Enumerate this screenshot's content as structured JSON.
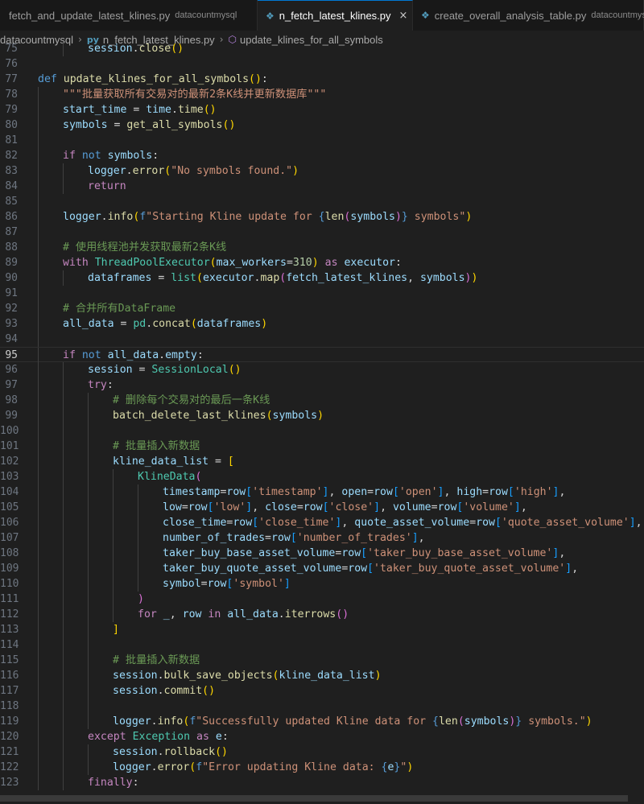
{
  "tabs": [
    {
      "icon": "python-file-icon",
      "label": "fetch_and_update_latest_klines.py",
      "desc": "datacountmysql",
      "active": false
    },
    {
      "icon": "python-file-icon",
      "label": "n_fetch_latest_klines.py",
      "desc": "",
      "active": true,
      "close": "×"
    },
    {
      "icon": "python-file-icon",
      "label": "create_overall_analysis_table.py",
      "desc": "datacountmysql",
      "active": false
    }
  ],
  "breadcrumb": [
    "datacountmysql",
    "n_fetch_latest_klines.py",
    "update_klines_for_all_symbols"
  ],
  "colors": {
    "keyword": "#569cd6",
    "control": "#c586c0",
    "function": "#dcdcaa",
    "string": "#ce9178",
    "comment": "#6a9955",
    "variable": "#9cdcfe",
    "class": "#4ec9b0",
    "accent": "#0078d4"
  },
  "current_line": 95,
  "code_lines": [
    {
      "n": "75",
      "indent": 2,
      "t": [
        [
          "var",
          "session"
        ],
        [
          "op",
          "."
        ],
        [
          "fn",
          "close"
        ],
        [
          "brk",
          "()"
        ]
      ]
    },
    {
      "n": "76",
      "indent": 0,
      "t": []
    },
    {
      "n": "77",
      "indent": 0,
      "t": [
        [
          "kw",
          "def"
        ],
        [
          "pn",
          " "
        ],
        [
          "fn",
          "update_klines_for_all_symbols"
        ],
        [
          "brk",
          "()"
        ],
        [
          "pn",
          ":"
        ]
      ]
    },
    {
      "n": "78",
      "indent": 1,
      "t": [
        [
          "str",
          "\"\"\"批量获取所有交易对的最新2条K线并更新数据库\"\"\""
        ]
      ]
    },
    {
      "n": "79",
      "indent": 1,
      "t": [
        [
          "var",
          "start_time"
        ],
        [
          "op",
          " = "
        ],
        [
          "var",
          "time"
        ],
        [
          "op",
          "."
        ],
        [
          "fn",
          "time"
        ],
        [
          "brk",
          "()"
        ]
      ]
    },
    {
      "n": "80",
      "indent": 1,
      "t": [
        [
          "var",
          "symbols"
        ],
        [
          "op",
          " = "
        ],
        [
          "fn",
          "get_all_symbols"
        ],
        [
          "brk",
          "()"
        ]
      ]
    },
    {
      "n": "81",
      "indent": 0,
      "t": []
    },
    {
      "n": "82",
      "indent": 1,
      "t": [
        [
          "ctl",
          "if"
        ],
        [
          "pn",
          " "
        ],
        [
          "kw",
          "not"
        ],
        [
          "pn",
          " "
        ],
        [
          "var",
          "symbols"
        ],
        [
          "pn",
          ":"
        ]
      ]
    },
    {
      "n": "83",
      "indent": 2,
      "t": [
        [
          "var",
          "logger"
        ],
        [
          "op",
          "."
        ],
        [
          "fn",
          "error"
        ],
        [
          "brk",
          "("
        ],
        [
          "str",
          "\"No symbols found.\""
        ],
        [
          "brk",
          ")"
        ]
      ]
    },
    {
      "n": "84",
      "indent": 2,
      "t": [
        [
          "ctl",
          "return"
        ]
      ]
    },
    {
      "n": "85",
      "indent": 0,
      "t": []
    },
    {
      "n": "86",
      "indent": 1,
      "t": [
        [
          "var",
          "logger"
        ],
        [
          "op",
          "."
        ],
        [
          "fn",
          "info"
        ],
        [
          "brk",
          "("
        ],
        [
          "kw",
          "f"
        ],
        [
          "str",
          "\"Starting Kline update for "
        ],
        [
          "kw",
          "{"
        ],
        [
          "fn",
          "len"
        ],
        [
          "brk2",
          "("
        ],
        [
          "var",
          "symbols"
        ],
        [
          "brk2",
          ")"
        ],
        [
          "kw",
          "}"
        ],
        [
          "str",
          " symbols\""
        ],
        [
          "brk",
          ")"
        ]
      ]
    },
    {
      "n": "87",
      "indent": 0,
      "t": []
    },
    {
      "n": "88",
      "indent": 1,
      "t": [
        [
          "cmt",
          "# 使用线程池并发获取最新2条K线"
        ]
      ]
    },
    {
      "n": "89",
      "indent": 1,
      "t": [
        [
          "ctl",
          "with"
        ],
        [
          "pn",
          " "
        ],
        [
          "cls",
          "ThreadPoolExecutor"
        ],
        [
          "brk",
          "("
        ],
        [
          "var",
          "max_workers"
        ],
        [
          "op",
          "="
        ],
        [
          "num",
          "310"
        ],
        [
          "brk",
          ")"
        ],
        [
          "pn",
          " "
        ],
        [
          "ctl",
          "as"
        ],
        [
          "pn",
          " "
        ],
        [
          "var",
          "executor"
        ],
        [
          "pn",
          ":"
        ]
      ]
    },
    {
      "n": "90",
      "indent": 2,
      "t": [
        [
          "var",
          "dataframes"
        ],
        [
          "op",
          " = "
        ],
        [
          "bi",
          "list"
        ],
        [
          "brk",
          "("
        ],
        [
          "var",
          "executor"
        ],
        [
          "op",
          "."
        ],
        [
          "fn",
          "map"
        ],
        [
          "brk2",
          "("
        ],
        [
          "var",
          "fetch_latest_klines"
        ],
        [
          "pn",
          ", "
        ],
        [
          "var",
          "symbols"
        ],
        [
          "brk2",
          ")"
        ],
        [
          "brk",
          ")"
        ]
      ]
    },
    {
      "n": "91",
      "indent": 0,
      "t": []
    },
    {
      "n": "92",
      "indent": 1,
      "t": [
        [
          "cmt",
          "# 合并所有DataFrame"
        ]
      ]
    },
    {
      "n": "93",
      "indent": 1,
      "t": [
        [
          "var",
          "all_data"
        ],
        [
          "op",
          " = "
        ],
        [
          "cls",
          "pd"
        ],
        [
          "op",
          "."
        ],
        [
          "fn",
          "concat"
        ],
        [
          "brk",
          "("
        ],
        [
          "var",
          "dataframes"
        ],
        [
          "brk",
          ")"
        ]
      ]
    },
    {
      "n": "94",
      "indent": 0,
      "t": []
    },
    {
      "n": "95",
      "indent": 1,
      "t": [
        [
          "ctl",
          "if"
        ],
        [
          "pn",
          " "
        ],
        [
          "kw",
          "not"
        ],
        [
          "pn",
          " "
        ],
        [
          "var",
          "all_data"
        ],
        [
          "op",
          "."
        ],
        [
          "var",
          "empty"
        ],
        [
          "pn",
          ":"
        ]
      ]
    },
    {
      "n": "96",
      "indent": 2,
      "t": [
        [
          "var",
          "session"
        ],
        [
          "op",
          " = "
        ],
        [
          "cls",
          "SessionLocal"
        ],
        [
          "brk",
          "()"
        ]
      ]
    },
    {
      "n": "97",
      "indent": 2,
      "t": [
        [
          "ctl",
          "try"
        ],
        [
          "pn",
          ":"
        ]
      ]
    },
    {
      "n": "98",
      "indent": 3,
      "t": [
        [
          "cmt",
          "# 删除每个交易对的最后一条K线"
        ]
      ]
    },
    {
      "n": "99",
      "indent": 3,
      "t": [
        [
          "fn",
          "batch_delete_last_klines"
        ],
        [
          "brk",
          "("
        ],
        [
          "var",
          "symbols"
        ],
        [
          "brk",
          ")"
        ]
      ]
    },
    {
      "n": "100",
      "indent": 0,
      "t": []
    },
    {
      "n": "101",
      "indent": 3,
      "t": [
        [
          "cmt",
          "# 批量插入新数据"
        ]
      ]
    },
    {
      "n": "102",
      "indent": 3,
      "t": [
        [
          "var",
          "kline_data_list"
        ],
        [
          "op",
          " = "
        ],
        [
          "brk",
          "["
        ]
      ]
    },
    {
      "n": "103",
      "indent": 4,
      "t": [
        [
          "cls",
          "KlineData"
        ],
        [
          "brk2",
          "("
        ]
      ]
    },
    {
      "n": "104",
      "indent": 5,
      "t": [
        [
          "var",
          "timestamp"
        ],
        [
          "op",
          "="
        ],
        [
          "var",
          "row"
        ],
        [
          "brk3",
          "["
        ],
        [
          "str",
          "'timestamp'"
        ],
        [
          "brk3",
          "]"
        ],
        [
          "pn",
          ", "
        ],
        [
          "var",
          "open"
        ],
        [
          "op",
          "="
        ],
        [
          "var",
          "row"
        ],
        [
          "brk3",
          "["
        ],
        [
          "str",
          "'open'"
        ],
        [
          "brk3",
          "]"
        ],
        [
          "pn",
          ", "
        ],
        [
          "var",
          "high"
        ],
        [
          "op",
          "="
        ],
        [
          "var",
          "row"
        ],
        [
          "brk3",
          "["
        ],
        [
          "str",
          "'high'"
        ],
        [
          "brk3",
          "]"
        ],
        [
          "pn",
          ","
        ]
      ]
    },
    {
      "n": "105",
      "indent": 5,
      "t": [
        [
          "var",
          "low"
        ],
        [
          "op",
          "="
        ],
        [
          "var",
          "row"
        ],
        [
          "brk3",
          "["
        ],
        [
          "str",
          "'low'"
        ],
        [
          "brk3",
          "]"
        ],
        [
          "pn",
          ", "
        ],
        [
          "var",
          "close"
        ],
        [
          "op",
          "="
        ],
        [
          "var",
          "row"
        ],
        [
          "brk3",
          "["
        ],
        [
          "str",
          "'close'"
        ],
        [
          "brk3",
          "]"
        ],
        [
          "pn",
          ", "
        ],
        [
          "var",
          "volume"
        ],
        [
          "op",
          "="
        ],
        [
          "var",
          "row"
        ],
        [
          "brk3",
          "["
        ],
        [
          "str",
          "'volume'"
        ],
        [
          "brk3",
          "]"
        ],
        [
          "pn",
          ","
        ]
      ]
    },
    {
      "n": "106",
      "indent": 5,
      "t": [
        [
          "var",
          "close_time"
        ],
        [
          "op",
          "="
        ],
        [
          "var",
          "row"
        ],
        [
          "brk3",
          "["
        ],
        [
          "str",
          "'close_time'"
        ],
        [
          "brk3",
          "]"
        ],
        [
          "pn",
          ", "
        ],
        [
          "var",
          "quote_asset_volume"
        ],
        [
          "op",
          "="
        ],
        [
          "var",
          "row"
        ],
        [
          "brk3",
          "["
        ],
        [
          "str",
          "'quote_asset_volume'"
        ],
        [
          "brk3",
          "]"
        ],
        [
          "pn",
          ","
        ]
      ]
    },
    {
      "n": "107",
      "indent": 5,
      "t": [
        [
          "var",
          "number_of_trades"
        ],
        [
          "op",
          "="
        ],
        [
          "var",
          "row"
        ],
        [
          "brk3",
          "["
        ],
        [
          "str",
          "'number_of_trades'"
        ],
        [
          "brk3",
          "]"
        ],
        [
          "pn",
          ","
        ]
      ]
    },
    {
      "n": "108",
      "indent": 5,
      "t": [
        [
          "var",
          "taker_buy_base_asset_volume"
        ],
        [
          "op",
          "="
        ],
        [
          "var",
          "row"
        ],
        [
          "brk3",
          "["
        ],
        [
          "str",
          "'taker_buy_base_asset_volume'"
        ],
        [
          "brk3",
          "]"
        ],
        [
          "pn",
          ","
        ]
      ]
    },
    {
      "n": "109",
      "indent": 5,
      "t": [
        [
          "var",
          "taker_buy_quote_asset_volume"
        ],
        [
          "op",
          "="
        ],
        [
          "var",
          "row"
        ],
        [
          "brk3",
          "["
        ],
        [
          "str",
          "'taker_buy_quote_asset_volume'"
        ],
        [
          "brk3",
          "]"
        ],
        [
          "pn",
          ","
        ]
      ]
    },
    {
      "n": "110",
      "indent": 5,
      "t": [
        [
          "var",
          "symbol"
        ],
        [
          "op",
          "="
        ],
        [
          "var",
          "row"
        ],
        [
          "brk3",
          "["
        ],
        [
          "str",
          "'symbol'"
        ],
        [
          "brk3",
          "]"
        ]
      ]
    },
    {
      "n": "111",
      "indent": 4,
      "t": [
        [
          "brk2",
          ")"
        ]
      ]
    },
    {
      "n": "112",
      "indent": 4,
      "t": [
        [
          "ctl",
          "for"
        ],
        [
          "pn",
          " "
        ],
        [
          "var",
          "_"
        ],
        [
          "pn",
          ", "
        ],
        [
          "var",
          "row"
        ],
        [
          "pn",
          " "
        ],
        [
          "ctl",
          "in"
        ],
        [
          "pn",
          " "
        ],
        [
          "var",
          "all_data"
        ],
        [
          "op",
          "."
        ],
        [
          "fn",
          "iterrows"
        ],
        [
          "brk2",
          "()"
        ]
      ]
    },
    {
      "n": "113",
      "indent": 3,
      "t": [
        [
          "brk",
          "]"
        ]
      ]
    },
    {
      "n": "114",
      "indent": 0,
      "t": []
    },
    {
      "n": "115",
      "indent": 3,
      "t": [
        [
          "cmt",
          "# 批量插入新数据"
        ]
      ]
    },
    {
      "n": "116",
      "indent": 3,
      "t": [
        [
          "var",
          "session"
        ],
        [
          "op",
          "."
        ],
        [
          "fn",
          "bulk_save_objects"
        ],
        [
          "brk",
          "("
        ],
        [
          "var",
          "kline_data_list"
        ],
        [
          "brk",
          ")"
        ]
      ]
    },
    {
      "n": "117",
      "indent": 3,
      "t": [
        [
          "var",
          "session"
        ],
        [
          "op",
          "."
        ],
        [
          "fn",
          "commit"
        ],
        [
          "brk",
          "()"
        ]
      ]
    },
    {
      "n": "118",
      "indent": 0,
      "t": []
    },
    {
      "n": "119",
      "indent": 3,
      "t": [
        [
          "var",
          "logger"
        ],
        [
          "op",
          "."
        ],
        [
          "fn",
          "info"
        ],
        [
          "brk",
          "("
        ],
        [
          "kw",
          "f"
        ],
        [
          "str",
          "\"Successfully updated Kline data for "
        ],
        [
          "kw",
          "{"
        ],
        [
          "fn",
          "len"
        ],
        [
          "brk2",
          "("
        ],
        [
          "var",
          "symbols"
        ],
        [
          "brk2",
          ")"
        ],
        [
          "kw",
          "}"
        ],
        [
          "str",
          " symbols.\""
        ],
        [
          "brk",
          ")"
        ]
      ]
    },
    {
      "n": "120",
      "indent": 2,
      "t": [
        [
          "ctl",
          "except"
        ],
        [
          "pn",
          " "
        ],
        [
          "cls",
          "Exception"
        ],
        [
          "pn",
          " "
        ],
        [
          "ctl",
          "as"
        ],
        [
          "pn",
          " "
        ],
        [
          "var",
          "e"
        ],
        [
          "pn",
          ":"
        ]
      ]
    },
    {
      "n": "121",
      "indent": 3,
      "t": [
        [
          "var",
          "session"
        ],
        [
          "op",
          "."
        ],
        [
          "fn",
          "rollback"
        ],
        [
          "brk",
          "()"
        ]
      ]
    },
    {
      "n": "122",
      "indent": 3,
      "t": [
        [
          "var",
          "logger"
        ],
        [
          "op",
          "."
        ],
        [
          "fn",
          "error"
        ],
        [
          "brk",
          "("
        ],
        [
          "kw",
          "f"
        ],
        [
          "str",
          "\"Error updating Kline data: "
        ],
        [
          "kw",
          "{"
        ],
        [
          "var",
          "e"
        ],
        [
          "kw",
          "}"
        ],
        [
          "str",
          "\""
        ],
        [
          "brk",
          ")"
        ]
      ]
    },
    {
      "n": "123",
      "indent": 2,
      "t": [
        [
          "ctl",
          "finally"
        ],
        [
          "pn",
          ":"
        ]
      ]
    }
  ]
}
